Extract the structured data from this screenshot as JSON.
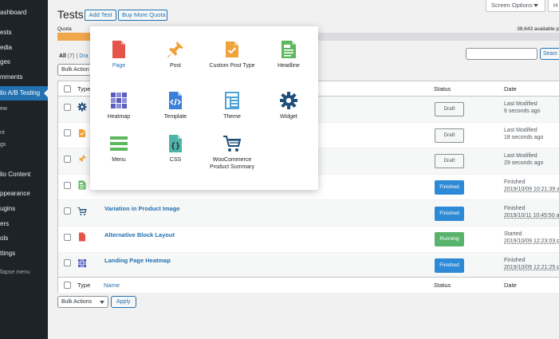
{
  "sidebar": {
    "items": [
      {
        "label": "ashboard"
      },
      {
        "label": "ests"
      },
      {
        "label": "edia"
      },
      {
        "label": "ges"
      },
      {
        "label": "mments"
      },
      {
        "label": "lio A/B Testing"
      },
      {
        "label": "ew"
      },
      {
        "label": "nt"
      },
      {
        "label": "gs"
      },
      {
        "label": "lio Content"
      },
      {
        "label": "ppearance"
      },
      {
        "label": "ugins"
      },
      {
        "label": "ers"
      },
      {
        "label": "ols"
      },
      {
        "label": "ttings"
      },
      {
        "label": "llapse menu"
      }
    ]
  },
  "header": {
    "title": "Tests",
    "add_test": "Add Test",
    "buy_quota": "Buy More Quota",
    "screen_options": "Screen Options",
    "help": "H"
  },
  "quota": {
    "label": "Quota",
    "available": "38,643 available p",
    "used_fraction": 0.07
  },
  "filters": {
    "all": "All",
    "all_count": "(7)",
    "sep": "|",
    "drafts": "Dra"
  },
  "search": {
    "button": "Searc"
  },
  "bulk": {
    "top_label": "Bulk Action",
    "bottom_label": "Bulk Actions",
    "apply": "Apply"
  },
  "table": {
    "columns": {
      "type": "Type",
      "name": "Name",
      "status": "Status",
      "date": "Date"
    },
    "rows": [
      {
        "icon": "gear-icon",
        "name": "",
        "status": "Draft",
        "status_kind": "draft",
        "date1": "Last Modified",
        "date2": "6 seconds ago"
      },
      {
        "icon": "custom-post-icon",
        "name": "",
        "status": "Draft",
        "status_kind": "draft",
        "date1": "Last Modified",
        "date2": "18 seconds ago"
      },
      {
        "icon": "pin-icon",
        "name": "",
        "status": "Draft",
        "status_kind": "draft",
        "date1": "Last Modified",
        "date2": "29 seconds ago"
      },
      {
        "icon": "headline-icon",
        "name": "",
        "status": "Finished",
        "status_kind": "finished",
        "date1": "Finished",
        "date2": "2019/10/09 10:21:39 a"
      },
      {
        "icon": "cart-icon",
        "name": "Variation in Product Image",
        "status": "Finished",
        "status_kind": "finished",
        "date1": "Finished",
        "date2": "2019/10/11 10:45:50 a"
      },
      {
        "icon": "page-icon",
        "name": "Alternative Block Layout",
        "status": "Running",
        "status_kind": "running",
        "date1": "Started",
        "date2": "2019/10/09 12:23:03 p"
      },
      {
        "icon": "heatmap-icon",
        "name": "Landing Page Heatmap",
        "status": "Finished",
        "status_kind": "finished",
        "date1": "Finished",
        "date2": "2019/10/09 12:21:25 p"
      }
    ]
  },
  "popup": {
    "tiles": [
      {
        "icon": "page-icon",
        "label": "Page"
      },
      {
        "icon": "pin-icon",
        "label": "Post"
      },
      {
        "icon": "custom-post-icon",
        "label": "Custom Post Type"
      },
      {
        "icon": "headline-icon",
        "label": "Headline"
      },
      {
        "icon": "heatmap-icon",
        "label": "Heatmap"
      },
      {
        "icon": "template-icon",
        "label": "Template"
      },
      {
        "icon": "theme-icon",
        "label": "Theme"
      },
      {
        "icon": "widget-icon",
        "label": "Widget"
      },
      {
        "icon": "menu-icon",
        "label": "Menu"
      },
      {
        "icon": "css-icon",
        "label": "CSS"
      },
      {
        "icon": "cart-icon",
        "label": "WooCommerce Product Summary"
      }
    ]
  },
  "colors": {
    "accent": "#2271b1",
    "sidebar_bg": "#1d2327",
    "quota_fill": "#f0a64b",
    "finished": "#2d8ad7",
    "running": "#58b36c"
  }
}
